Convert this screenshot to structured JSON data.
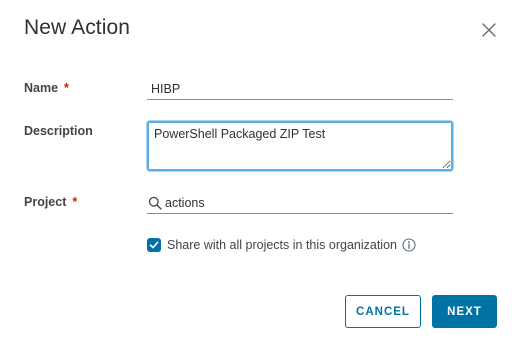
{
  "dialog": {
    "title": "New Action",
    "close_icon": "close-icon"
  },
  "form": {
    "name": {
      "label": "Name",
      "required_marker": "*",
      "value": "HIBP"
    },
    "description": {
      "label": "Description",
      "value": "PowerShell Packaged ZIP Test"
    },
    "project": {
      "label": "Project",
      "required_marker": "*",
      "icon": "search-icon",
      "value": "actions"
    },
    "share": {
      "checked": true,
      "label": "Share with all projects in this organization",
      "info_icon": "info-icon"
    }
  },
  "buttons": {
    "cancel_label": "CANCEL",
    "next_label": "NEXT"
  },
  "colors": {
    "primary": "#0072a3",
    "required": "#c92100",
    "focus": "#5bb1e3"
  }
}
